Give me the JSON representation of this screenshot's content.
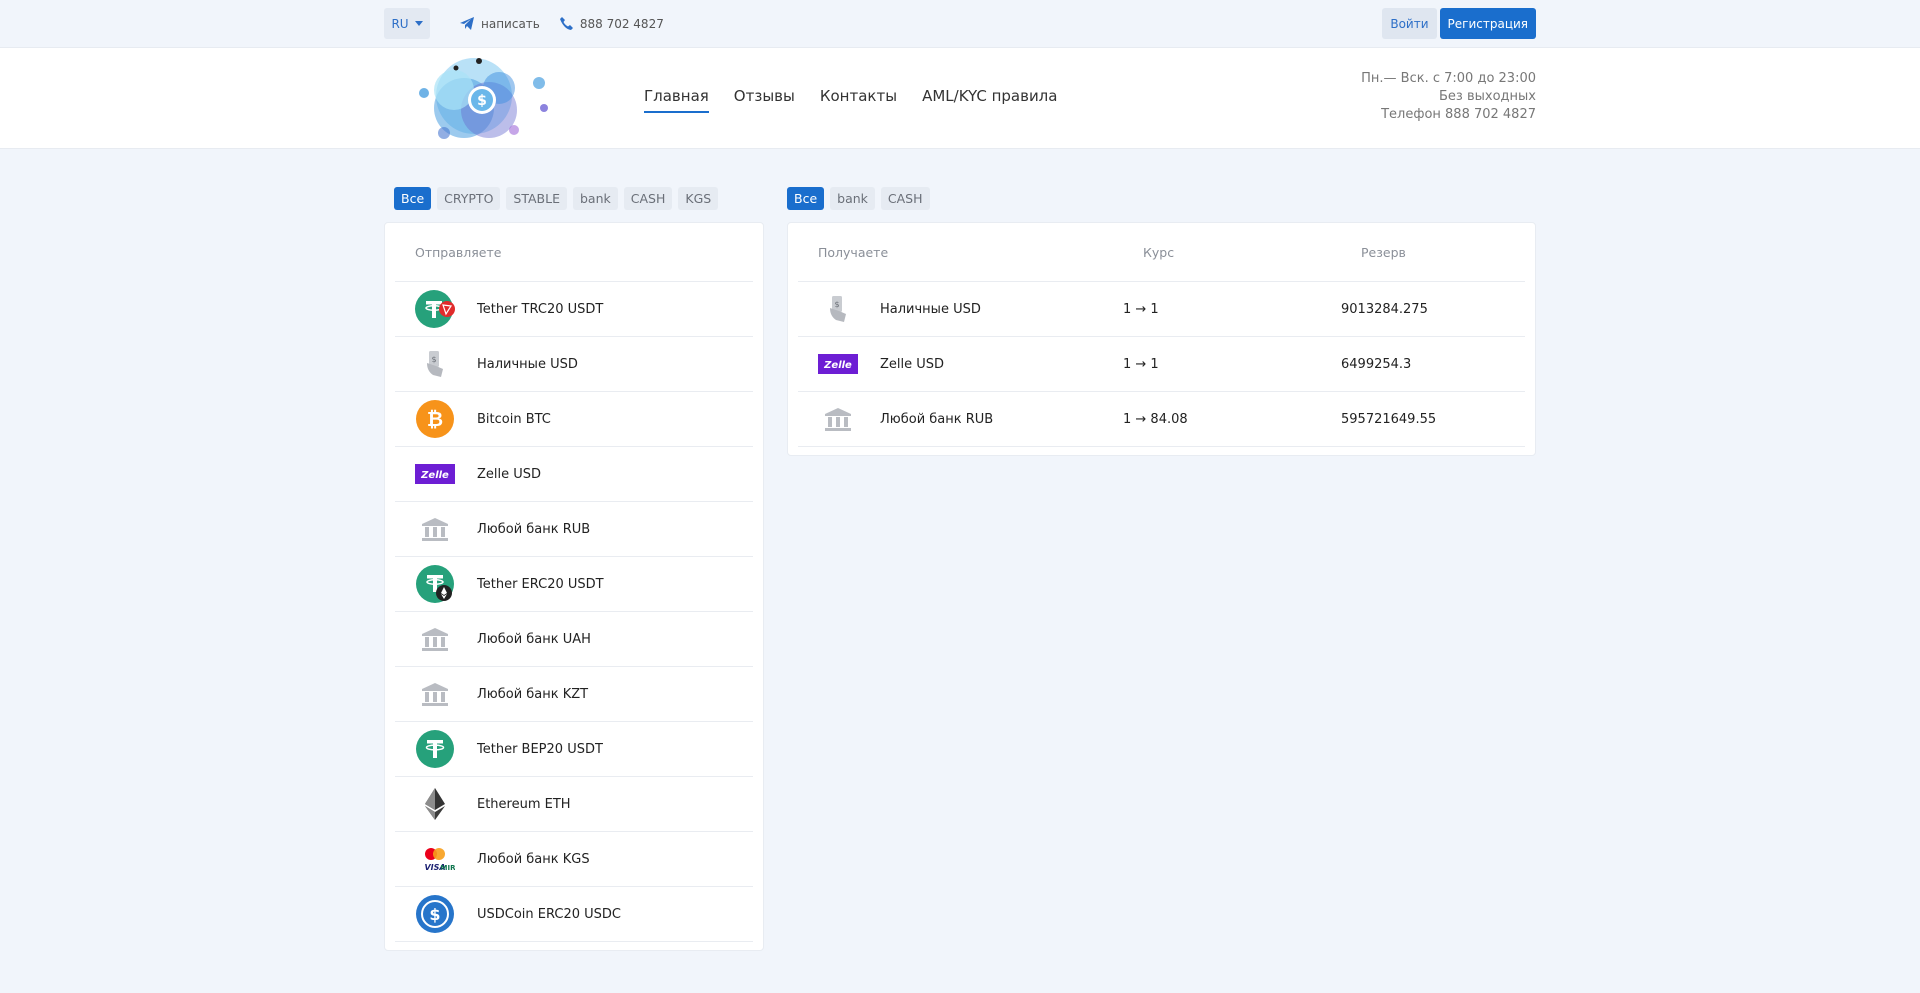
{
  "topbar": {
    "lang": "RU",
    "write_label": "написать",
    "phone": "888 702 4827",
    "login": "Войти",
    "register": "Регистрация"
  },
  "nav": [
    {
      "label": "Главная"
    },
    {
      "label": "Отзывы"
    },
    {
      "label": "Контакты"
    },
    {
      "label": "AML/KYC правила"
    }
  ],
  "schedule": {
    "line1": "Пн.— Вск. с 7:00 до 23:00",
    "line2": "Без выходных",
    "line3": "Телефон 888 702 4827"
  },
  "send_filters": [
    "Все",
    "CRYPTO",
    "STABLE",
    "bank",
    "CASH",
    "KGS"
  ],
  "receive_filters": [
    "Все",
    "bank",
    "CASH"
  ],
  "send_panel": {
    "header": "Отправляете",
    "items": [
      {
        "name": "Tether TRC20 USDT",
        "icon": "tether-trc20-icon"
      },
      {
        "name": "Наличные USD",
        "icon": "cash-hand-icon"
      },
      {
        "name": "Bitcoin BTC",
        "icon": "bitcoin-icon"
      },
      {
        "name": "Zelle USD",
        "icon": "zelle-icon"
      },
      {
        "name": "Любой банк RUB",
        "icon": "bank-icon"
      },
      {
        "name": "Tether ERC20 USDT",
        "icon": "tether-erc20-icon"
      },
      {
        "name": "Любой банк UAH",
        "icon": "bank-icon"
      },
      {
        "name": "Любой банк KZT",
        "icon": "bank-icon"
      },
      {
        "name": "Tether BEP20 USDT",
        "icon": "tether-icon"
      },
      {
        "name": "Ethereum ETH",
        "icon": "ethereum-icon"
      },
      {
        "name": "Любой банк KGS",
        "icon": "visa-mir-icon"
      },
      {
        "name": "USDCoin ERC20 USDC",
        "icon": "usdc-icon"
      }
    ]
  },
  "receive_panel": {
    "header_name": "Получаете",
    "header_rate": "Курс",
    "header_reserve": "Резерв",
    "items": [
      {
        "name": "Наличные USD",
        "rate": "1 → 1",
        "reserve": "9013284.275",
        "icon": "cash-hand-icon"
      },
      {
        "name": "Zelle USD",
        "rate": "1 → 1",
        "reserve": "6499254.3",
        "icon": "zelle-icon"
      },
      {
        "name": "Любой банк RUB",
        "rate": "1 → 84.08",
        "reserve": "595721649.55",
        "icon": "bank-icon"
      }
    ]
  },
  "colors": {
    "accent": "#1a6ecd",
    "background": "#f1f5fb",
    "tether": "#26a17b",
    "bitcoin": "#f7931a",
    "zelle": "#6d1ed4",
    "usdc": "#2775ca"
  }
}
